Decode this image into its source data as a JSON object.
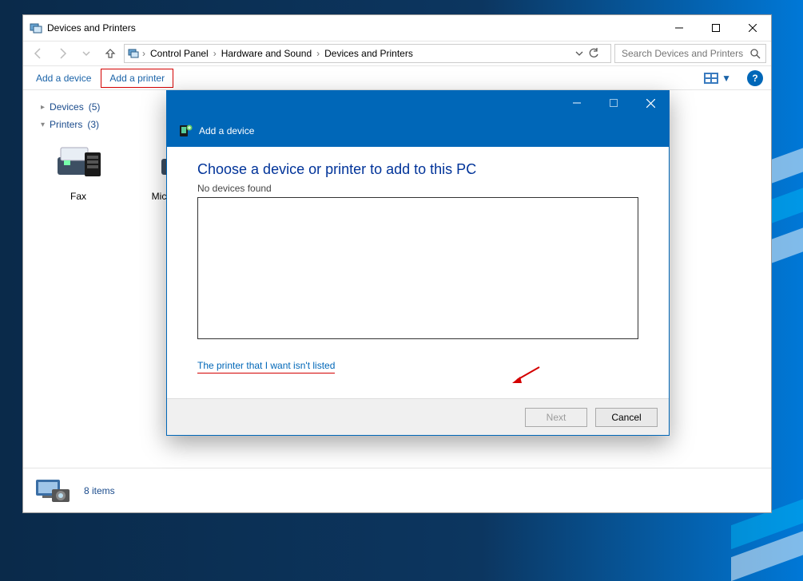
{
  "window": {
    "title": "Devices and Printers"
  },
  "breadcrumb": {
    "seg1": "Control Panel",
    "seg2": "Hardware and Sound",
    "seg3": "Devices and Printers"
  },
  "search": {
    "placeholder": "Search Devices and Printers"
  },
  "commands": {
    "add_device": "Add a device",
    "add_printer": "Add a printer"
  },
  "groups": {
    "devices": {
      "label": "Devices",
      "count": "(5)"
    },
    "printers": {
      "label": "Printers",
      "count": "(3)"
    }
  },
  "printers": [
    {
      "label": "Fax"
    },
    {
      "label": "Microsoft Print to PDF"
    }
  ],
  "status": {
    "items": "8 items"
  },
  "dialog": {
    "header": "Add a device",
    "heading": "Choose a device or printer to add to this PC",
    "sub": "No devices found",
    "link": "The printer that I want isn't listed",
    "next": "Next",
    "cancel": "Cancel"
  }
}
